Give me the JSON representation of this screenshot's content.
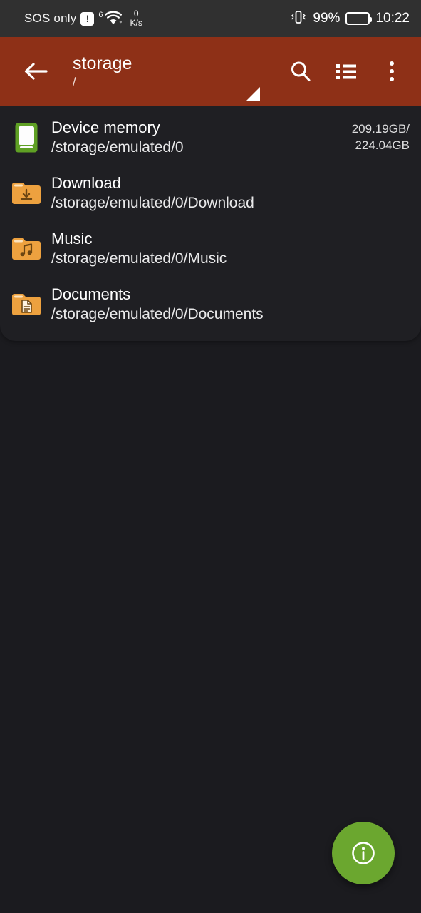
{
  "statusbar": {
    "carrier": "SOS only",
    "alert_icon": "!",
    "wifi_generation": "6",
    "network_speed_value": "0",
    "network_speed_unit": "K/s",
    "battery_percent": "99%",
    "time": "10:22"
  },
  "appbar": {
    "title": "storage",
    "subtitle": "/",
    "back_icon": "arrow-left",
    "search_icon": "search",
    "view_icon": "list-view",
    "overflow_icon": "more-vertical",
    "background_color": "#8e3017"
  },
  "files": [
    {
      "name": "Device memory",
      "path": "/storage/emulated/0",
      "meta_line1": "209.19GB/",
      "meta_line2": "224.04GB",
      "icon": "device-memory-icon",
      "icon_color": "#5fa024"
    },
    {
      "name": "Download",
      "path": "/storage/emulated/0/Download",
      "meta_line1": "",
      "meta_line2": "",
      "icon": "folder-download-icon",
      "icon_color": "#eda13f"
    },
    {
      "name": "Music",
      "path": "/storage/emulated/0/Music",
      "meta_line1": "",
      "meta_line2": "",
      "icon": "folder-music-icon",
      "icon_color": "#eda13f"
    },
    {
      "name": "Documents",
      "path": "/storage/emulated/0/Documents",
      "meta_line1": "",
      "meta_line2": "",
      "icon": "folder-documents-icon",
      "icon_color": "#eda13f"
    }
  ],
  "fab": {
    "icon": "info-icon",
    "color": "#6ba72f"
  }
}
